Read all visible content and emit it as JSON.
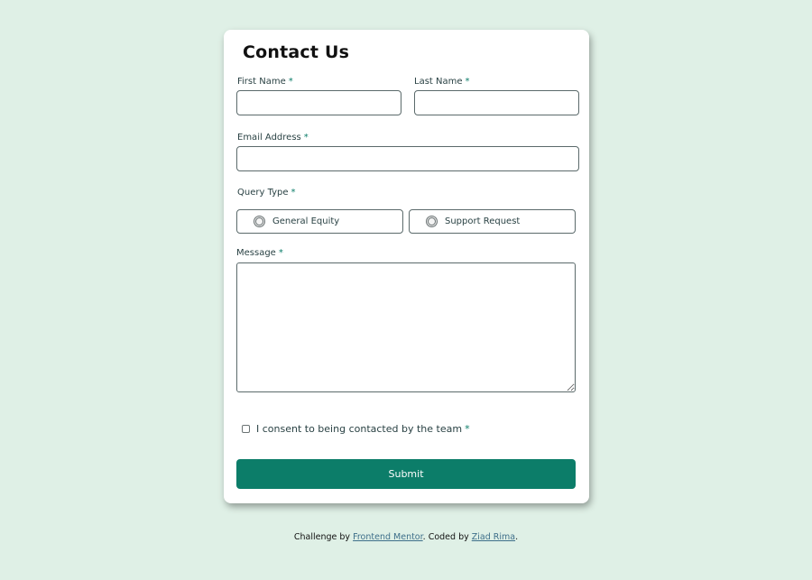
{
  "form": {
    "title": "Contact Us",
    "required_marker": "*",
    "first_name": {
      "label": "First Name",
      "value": ""
    },
    "last_name": {
      "label": "Last Name",
      "value": ""
    },
    "email": {
      "label": "Email Address",
      "value": ""
    },
    "query_type": {
      "label": "Query Type",
      "options": [
        "General Equity",
        "Support Request"
      ]
    },
    "message": {
      "label": "Message",
      "value": ""
    },
    "consent": {
      "label": "I consent to being contacted by the team",
      "checked": false
    },
    "submit_label": "Submit"
  },
  "attribution": {
    "prefix": "Challenge by",
    "challenge_link": "Frontend Mentor",
    "middle": ". Coded by",
    "author_link": "Ziad Rima",
    "suffix": "."
  },
  "colors": {
    "background": "#dff0e6",
    "accent": "#0c7d69",
    "link": "#3e6f8a"
  }
}
